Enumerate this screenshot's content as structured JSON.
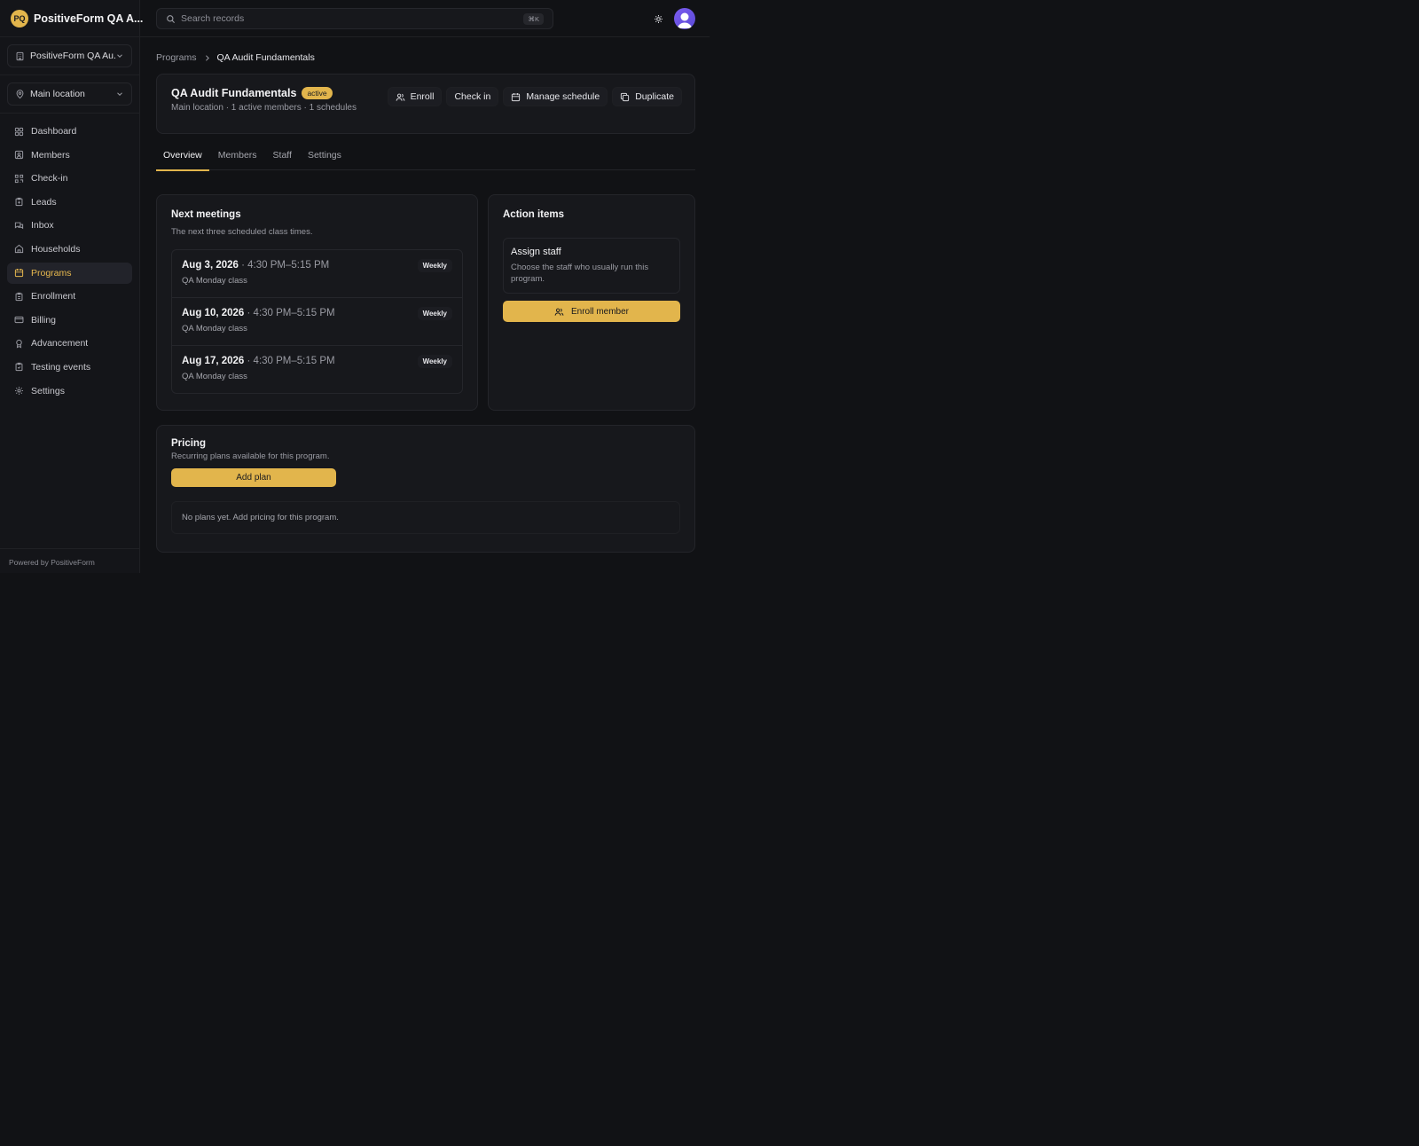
{
  "brand": {
    "initials": "PQ",
    "name": "PositiveForm QA A..."
  },
  "org_selector": {
    "value": "PositiveForm QA Au..."
  },
  "location_selector": {
    "value": "Main location"
  },
  "nav": [
    {
      "label": "Dashboard",
      "icon": "dashboard-icon"
    },
    {
      "label": "Members",
      "icon": "members-icon"
    },
    {
      "label": "Check-in",
      "icon": "check-in-icon"
    },
    {
      "label": "Leads",
      "icon": "leads-icon"
    },
    {
      "label": "Inbox",
      "icon": "inbox-icon"
    },
    {
      "label": "Households",
      "icon": "home-icon"
    },
    {
      "label": "Programs",
      "icon": "calendar-icon",
      "active": true
    },
    {
      "label": "Enrollment",
      "icon": "clipboard-icon"
    },
    {
      "label": "Billing",
      "icon": "credit-card-icon"
    },
    {
      "label": "Advancement",
      "icon": "award-icon"
    },
    {
      "label": "Testing events",
      "icon": "clipboard-check-icon"
    },
    {
      "label": "Settings",
      "icon": "gear-icon"
    }
  ],
  "footer": "Powered by PositiveForm",
  "search": {
    "placeholder": "Search records",
    "shortcut": "⌘K"
  },
  "breadcrumb": {
    "parent": "Programs",
    "current": "QA Audit Fundamentals"
  },
  "program": {
    "title": "QA Audit Fundamentals",
    "status": "active",
    "subtitle": "Main location · 1 active members · 1 schedules",
    "actions": {
      "enroll": "Enroll",
      "check_in": "Check in",
      "manage_schedule": "Manage schedule",
      "duplicate": "Duplicate"
    }
  },
  "tabs": [
    "Overview",
    "Members",
    "Staff",
    "Settings"
  ],
  "meetings": {
    "title": "Next meetings",
    "description": "The next three scheduled class times.",
    "items": [
      {
        "date": "Aug 3, 2026",
        "time": " · 4:30 PM–5:15 PM",
        "name": "QA Monday class",
        "badge": "Weekly"
      },
      {
        "date": "Aug 10, 2026",
        "time": " · 4:30 PM–5:15 PM",
        "name": "QA Monday class",
        "badge": "Weekly"
      },
      {
        "date": "Aug 17, 2026",
        "time": " · 4:30 PM–5:15 PM",
        "name": "QA Monday class",
        "badge": "Weekly"
      }
    ]
  },
  "action_items": {
    "title": "Action items",
    "assign_title": "Assign staff",
    "assign_desc": "Choose the staff who usually run this program.",
    "enroll_member": "Enroll member"
  },
  "pricing": {
    "title": "Pricing",
    "description": "Recurring plans available for this program.",
    "add_plan": "Add plan",
    "empty": "No plans yet. Add pricing for this program."
  },
  "colors": {
    "accent": "#e2b54c",
    "background": "#111215",
    "avatar": "#7c5cf0"
  }
}
